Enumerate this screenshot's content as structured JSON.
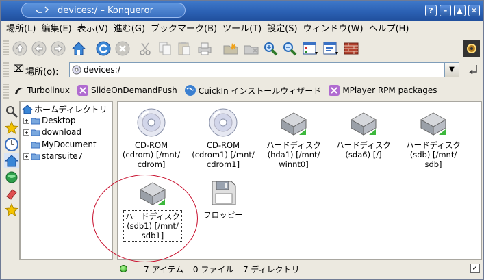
{
  "window": {
    "title": "devices:/ – Konqueror",
    "buttons": [
      "?",
      "–",
      "▲",
      "✕"
    ]
  },
  "menu": [
    "場所(L)",
    "編集(E)",
    "表示(V)",
    "進む(G)",
    "ブックマーク(B)",
    "ツール(T)",
    "設定(S)",
    "ウィンドウ(W)",
    "ヘルプ(H)"
  ],
  "location": {
    "label": "場所(o):",
    "value": "devices:/"
  },
  "bookmarks": [
    {
      "label": "Turbolinux",
      "icon": "turbolinux-icon"
    },
    {
      "label": "SlideOnDemandPush",
      "icon": "konqueror-icon"
    },
    {
      "label": "CuickIn インストールウィザード",
      "icon": "globe-icon"
    },
    {
      "label": "MPlayer RPM packages",
      "icon": "konqueror-icon"
    }
  ],
  "tree": {
    "root": "ホームディレクトリ",
    "items": [
      "Desktop",
      "download",
      "MyDocument",
      "starsuite7"
    ]
  },
  "devices": [
    {
      "label": "CD-ROM\n(cdrom) [/mnt/\ncdrom]",
      "type": "cd"
    },
    {
      "label": "CD-ROM\n(cdrom1) [/mnt/\ncdrom1]",
      "type": "cd"
    },
    {
      "label": "ハードディスク\n(hda1) [/mnt/\nwinnt0]",
      "type": "hdd"
    },
    {
      "label": "ハードディスク\n(sda6) [/]",
      "type": "hdd"
    },
    {
      "label": "ハードディスク\n(sdb) [/mnt/\nsdb]",
      "type": "hdd"
    },
    {
      "label": "ハードディスク\n(sdb1) [/mnt/\nsdb1]",
      "type": "hdd",
      "selected": true
    },
    {
      "label": "フロッピー",
      "type": "floppy"
    }
  ],
  "status": {
    "text": "7 アイテム – 0 ファイル – 7 ディレクトリ"
  },
  "colors": {
    "title_bar": "#2a5fb2",
    "annotation": "#c8102e"
  }
}
